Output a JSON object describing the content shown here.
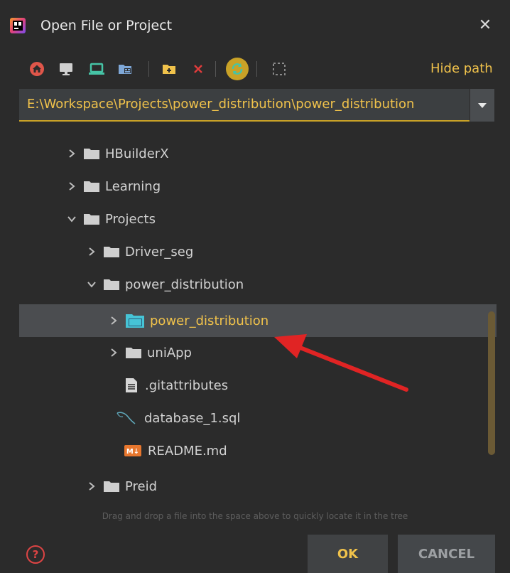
{
  "window": {
    "title": "Open File or Project",
    "close_glyph": "✕"
  },
  "toolbar": {
    "icons": [
      "home-icon",
      "desktop-icon",
      "laptop-icon",
      "project-folder-icon",
      "new-folder-icon",
      "delete-icon",
      "refresh-icon",
      "select-area-icon"
    ],
    "hide_path_label": "Hide path",
    "colors": {
      "home": "#e0564a",
      "desktop": "#d0d0d0",
      "laptop": "#46c4a6",
      "project": "#7fa8d8",
      "new_folder": "#f0c24b",
      "delete": "#e03c3c",
      "refresh": "#c9a227"
    }
  },
  "path": {
    "value": "E:\\Workspace\\Projects\\power_distribution\\power_distribution"
  },
  "tree": {
    "items": [
      {
        "label": "HBuilderX",
        "type": "folder",
        "expanded": false
      },
      {
        "label": "Learning",
        "type": "folder",
        "expanded": false
      },
      {
        "label": "Projects",
        "type": "folder",
        "expanded": true
      },
      {
        "label": "Driver_seg",
        "type": "folder",
        "expanded": false
      },
      {
        "label": "power_distribution",
        "type": "folder",
        "expanded": true
      },
      {
        "label": "power_distribution",
        "type": "project-folder",
        "expanded": false,
        "selected": true
      },
      {
        "label": "uniApp",
        "type": "folder",
        "expanded": false
      },
      {
        "label": ".gitattributes",
        "type": "text-file"
      },
      {
        "label": "database_1.sql",
        "type": "sql-file"
      },
      {
        "label": "README.md",
        "type": "markdown-file",
        "badge": "M↓"
      },
      {
        "label": "Preid",
        "type": "folder",
        "expanded": false
      }
    ]
  },
  "hint": "Drag and drop a file into the space above to quickly locate it in the tree",
  "footer": {
    "help_glyph": "?",
    "ok_label": "OK",
    "cancel_label": "CANCEL"
  },
  "colors": {
    "accent": "#f0c24b",
    "background": "#2b2b2b",
    "selection": "#4b4d50",
    "annotation_arrow": "#e02424"
  }
}
